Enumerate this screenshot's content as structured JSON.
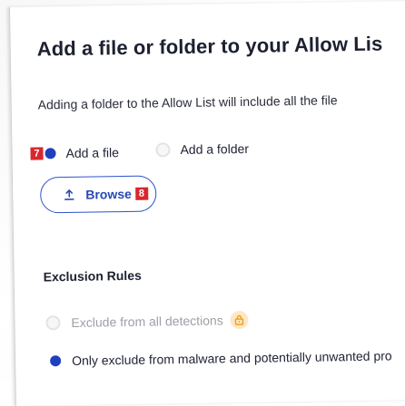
{
  "dialog": {
    "title": "Add a file or folder to your Allow Lis",
    "description": "Adding a folder to the Allow List will include all the file"
  },
  "options": {
    "file_marker": "7",
    "add_file_label": "Add a file",
    "add_folder_label": "Add a folder",
    "selected": "add_file"
  },
  "browse": {
    "label": "Browse",
    "marker": "8",
    "icon": "upload-icon"
  },
  "exclusion": {
    "title": "Exclusion Rules",
    "rule_all_label": "Exclude from all detections",
    "rule_all_icon": "lock-icon",
    "rule_malware_label": "Only exclude from malware and potentially unwanted pro",
    "selected": "malware"
  },
  "colors": {
    "accent_blue": "#2e54c7",
    "marker_red": "#d9272e",
    "lock_orange": "#f0a020"
  }
}
